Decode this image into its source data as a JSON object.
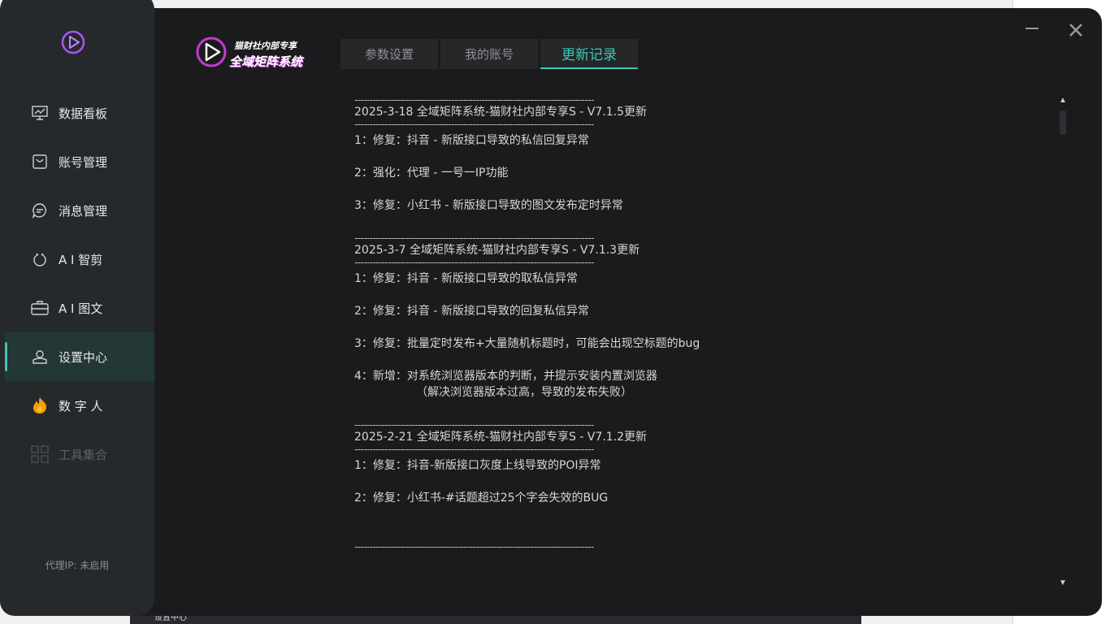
{
  "sidebar": {
    "items": [
      {
        "label": "数据看板",
        "icon": "chart-board-icon"
      },
      {
        "label": "账号管理",
        "icon": "account-bag-icon"
      },
      {
        "label": "消息管理",
        "icon": "chat-bubble-icon"
      },
      {
        "label": "A I 智剪",
        "icon": "ai-clip-icon"
      },
      {
        "label": "A I 图文",
        "icon": "briefcase-icon"
      },
      {
        "label": "设置中心",
        "icon": "settings-user-icon"
      },
      {
        "label": "数 字 人",
        "icon": "flame-icon"
      },
      {
        "label": "工具集合",
        "icon": "grid-icon"
      }
    ],
    "proxy_text": "代理IP: 未启用"
  },
  "brand": {
    "subtitle": "猫财社内部专享",
    "title": "全域矩阵系统"
  },
  "tabs": [
    {
      "label": "参数设置"
    },
    {
      "label": "我的账号"
    },
    {
      "label": "更新记录"
    }
  ],
  "changelog": {
    "divider": "-------------------------------------------------------------------------------",
    "entries": [
      {
        "title": "2025-3-18 全域矩阵系统-猫财社内部专享S - V7.1.5更新",
        "items": [
          "1：修复：抖音 - 新版接口导致的私信回复异常",
          "2：强化：代理 - 一号一IP功能",
          "3：修复：小红书 - 新版接口导致的图文发布定时异常"
        ]
      },
      {
        "title": "2025-3-7 全域矩阵系统-猫财社内部专享S - V7.1.3更新",
        "items": [
          "1：修复：抖音 - 新版接口导致的取私信异常",
          "2：修复：抖音 - 新版接口导致的回复私信异常",
          "3：修复：批量定时发布+大量随机标题时，可能会出现空标题的bug",
          "4：新增：对系统浏览器版本的判断，并提示安装内置浏览器"
        ],
        "sub": "（解决浏览器版本过高，导致的发布失败）"
      },
      {
        "title": "2025-2-21 全域矩阵系统-猫财社内部专享S - V7.1.2更新",
        "items": [
          "1：修复：抖音-新版接口灰度上线导致的POI异常",
          "2：修复：小红书-#话题超过25个字会失效的BUG"
        ]
      }
    ]
  },
  "background": {
    "bottom_label": "设置中心"
  },
  "colors": {
    "accent": "#3cc8b8",
    "brand_purple": "#c33bd3"
  }
}
